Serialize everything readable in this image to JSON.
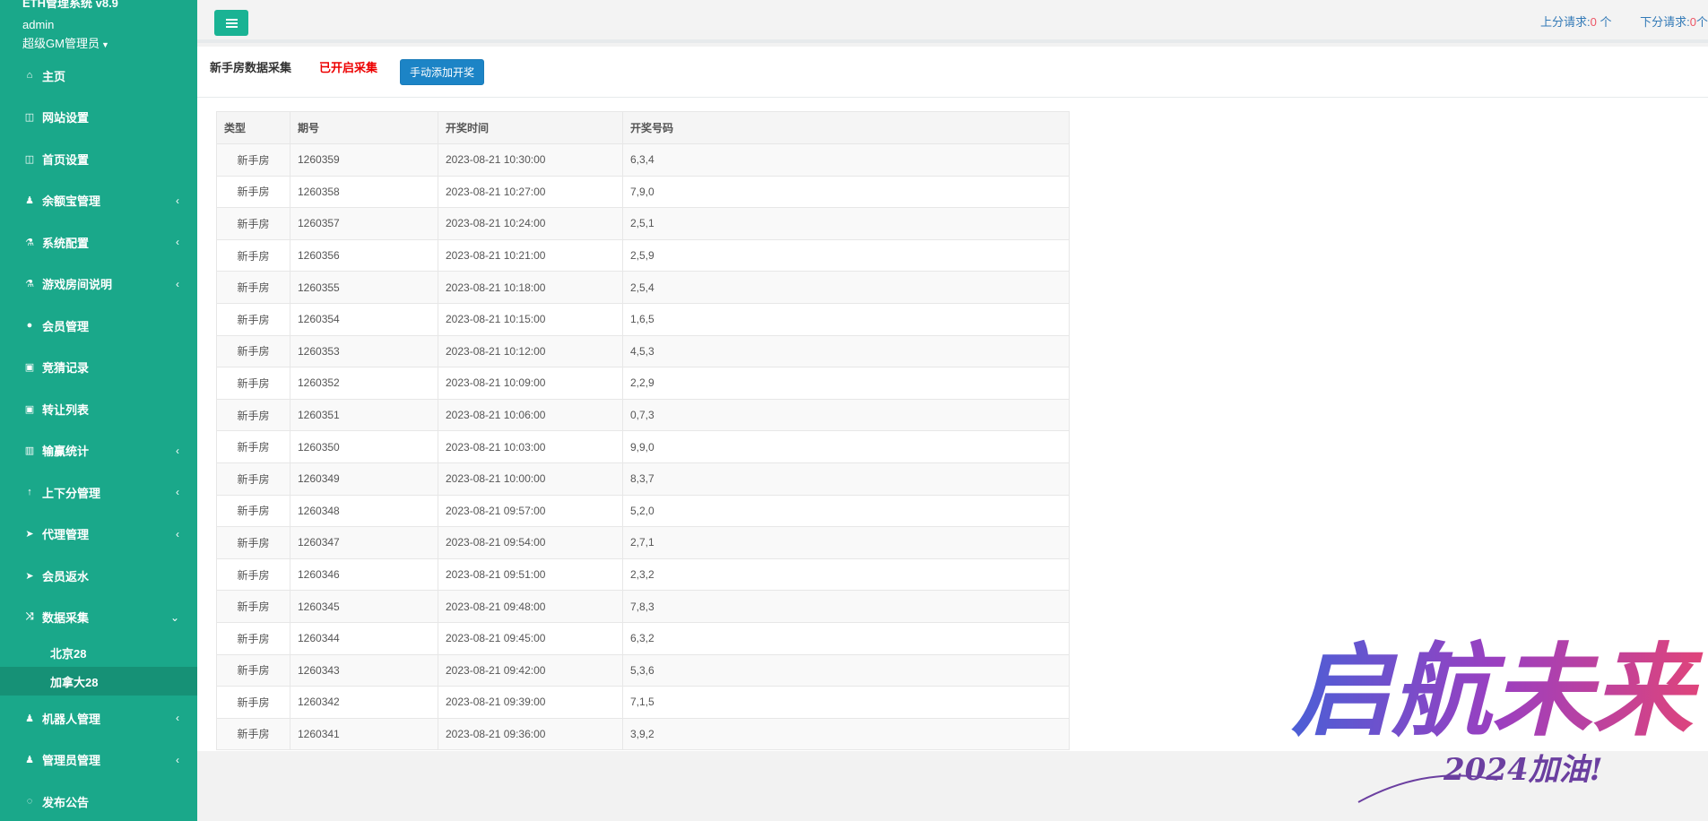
{
  "sidebar": {
    "system_name": "ETH管理系统 v8.9",
    "user": "admin",
    "role": "超级GM管理员",
    "items": [
      {
        "label": "主页",
        "icon": "home-icon",
        "glyph": "⌂",
        "has_children": false
      },
      {
        "label": "网站设置",
        "icon": "columns-icon",
        "glyph": "◫",
        "has_children": false
      },
      {
        "label": "首页设置",
        "icon": "columns-icon",
        "glyph": "◫",
        "has_children": false
      },
      {
        "label": "余额宝管理",
        "icon": "male-icon",
        "glyph": "♟",
        "has_children": true
      },
      {
        "label": "系统配置",
        "icon": "flask-icon",
        "glyph": "⚗",
        "has_children": true
      },
      {
        "label": "游戏房间说明",
        "icon": "flask-icon",
        "glyph": "⚗",
        "has_children": true
      },
      {
        "label": "会员管理",
        "icon": "user-icon",
        "glyph": "●",
        "has_children": false
      },
      {
        "label": "竞猜记录",
        "icon": "taxi-icon",
        "glyph": "▣",
        "has_children": false
      },
      {
        "label": "转让列表",
        "icon": "taxi-icon",
        "glyph": "▣",
        "has_children": false
      },
      {
        "label": "输赢统计",
        "icon": "bar-chart-icon",
        "glyph": "▥",
        "has_children": true
      },
      {
        "label": "上下分管理",
        "icon": "level-up-icon",
        "glyph": "↑",
        "has_children": true
      },
      {
        "label": "代理管理",
        "icon": "paper-plane-icon",
        "glyph": "➤",
        "has_children": true
      },
      {
        "label": "会员返水",
        "icon": "paper-plane-icon",
        "glyph": "➤",
        "has_children": false
      },
      {
        "label": "数据采集",
        "icon": "random-icon",
        "glyph": "⤨",
        "has_children": true,
        "open": true
      }
    ],
    "sub_items": [
      {
        "label": "北京28",
        "active": false
      },
      {
        "label": "加拿大28",
        "active": true
      }
    ],
    "items_after": [
      {
        "label": "机器人管理",
        "icon": "male-icon",
        "glyph": "♟",
        "has_children": true
      },
      {
        "label": "管理员管理",
        "icon": "male-icon",
        "glyph": "♟",
        "has_children": true
      },
      {
        "label": "发布公告",
        "icon": "comment-icon",
        "glyph": "◌",
        "has_children": false
      }
    ]
  },
  "topbar": {
    "up_label": "上分请求:",
    "up_count": "0",
    "up_unit": "个",
    "down_label": "下分请求:",
    "down_count": "0",
    "down_unit": "个"
  },
  "panel": {
    "title": "新手房数据采集",
    "status": "已开启采集",
    "button": "手动添加开奖"
  },
  "table": {
    "headers": [
      "类型",
      "期号",
      "开奖时间",
      "开奖号码"
    ],
    "rows": [
      [
        "新手房",
        "1260359",
        "2023-08-21 10:30:00",
        "6,3,4"
      ],
      [
        "新手房",
        "1260358",
        "2023-08-21 10:27:00",
        "7,9,0"
      ],
      [
        "新手房",
        "1260357",
        "2023-08-21 10:24:00",
        "2,5,1"
      ],
      [
        "新手房",
        "1260356",
        "2023-08-21 10:21:00",
        "2,5,9"
      ],
      [
        "新手房",
        "1260355",
        "2023-08-21 10:18:00",
        "2,5,4"
      ],
      [
        "新手房",
        "1260354",
        "2023-08-21 10:15:00",
        "1,6,5"
      ],
      [
        "新手房",
        "1260353",
        "2023-08-21 10:12:00",
        "4,5,3"
      ],
      [
        "新手房",
        "1260352",
        "2023-08-21 10:09:00",
        "2,2,9"
      ],
      [
        "新手房",
        "1260351",
        "2023-08-21 10:06:00",
        "0,7,3"
      ],
      [
        "新手房",
        "1260350",
        "2023-08-21 10:03:00",
        "9,9,0"
      ],
      [
        "新手房",
        "1260349",
        "2023-08-21 10:00:00",
        "8,3,7"
      ],
      [
        "新手房",
        "1260348",
        "2023-08-21 09:57:00",
        "5,2,0"
      ],
      [
        "新手房",
        "1260347",
        "2023-08-21 09:54:00",
        "2,7,1"
      ],
      [
        "新手房",
        "1260346",
        "2023-08-21 09:51:00",
        "2,3,2"
      ],
      [
        "新手房",
        "1260345",
        "2023-08-21 09:48:00",
        "7,8,3"
      ],
      [
        "新手房",
        "1260344",
        "2023-08-21 09:45:00",
        "6,3,2"
      ],
      [
        "新手房",
        "1260343",
        "2023-08-21 09:42:00",
        "5,3,6"
      ],
      [
        "新手房",
        "1260342",
        "2023-08-21 09:39:00",
        "7,1,5"
      ],
      [
        "新手房",
        "1260341",
        "2023-08-21 09:36:00",
        "3,9,2"
      ]
    ]
  },
  "watermark": {
    "main": "启航未来",
    "sub": "2024加油!"
  },
  "colors": {
    "sidebar_bg": "#1aa88a",
    "accent": "#1ab394",
    "primary_button": "#1c84c6",
    "status_red": "#ed0000",
    "link_blue": "#337ab7"
  }
}
